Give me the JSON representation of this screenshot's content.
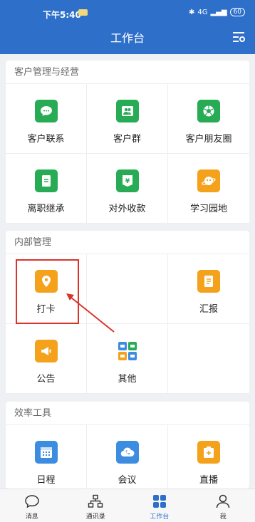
{
  "status_bar": {
    "time": "下午5:40",
    "network": "4G",
    "battery": "60"
  },
  "header": {
    "title": "工作台"
  },
  "sections": [
    {
      "title": "客户管理与经营",
      "items": [
        "客户联系",
        "客户群",
        "客户朋友圈",
        "离职继承",
        "对外收款",
        "学习园地"
      ]
    },
    {
      "title": "内部管理",
      "items": [
        "打卡",
        "",
        "汇报",
        "公告",
        "其他"
      ]
    },
    {
      "title": "效率工具",
      "items": [
        "日程",
        "会议",
        "直播"
      ]
    }
  ],
  "tabs": [
    {
      "label": "消息",
      "icon": "chat-bubble-icon"
    },
    {
      "label": "通讯录",
      "icon": "org-chart-icon"
    },
    {
      "label": "工作台",
      "icon": "grid-icon",
      "active": true
    },
    {
      "label": "我",
      "icon": "person-icon"
    }
  ],
  "colors": {
    "header": "#2e6fca",
    "green": "#27ac55",
    "orange": "#f4a21b",
    "blue": "#3c8de0",
    "highlight": "#d9342b"
  }
}
